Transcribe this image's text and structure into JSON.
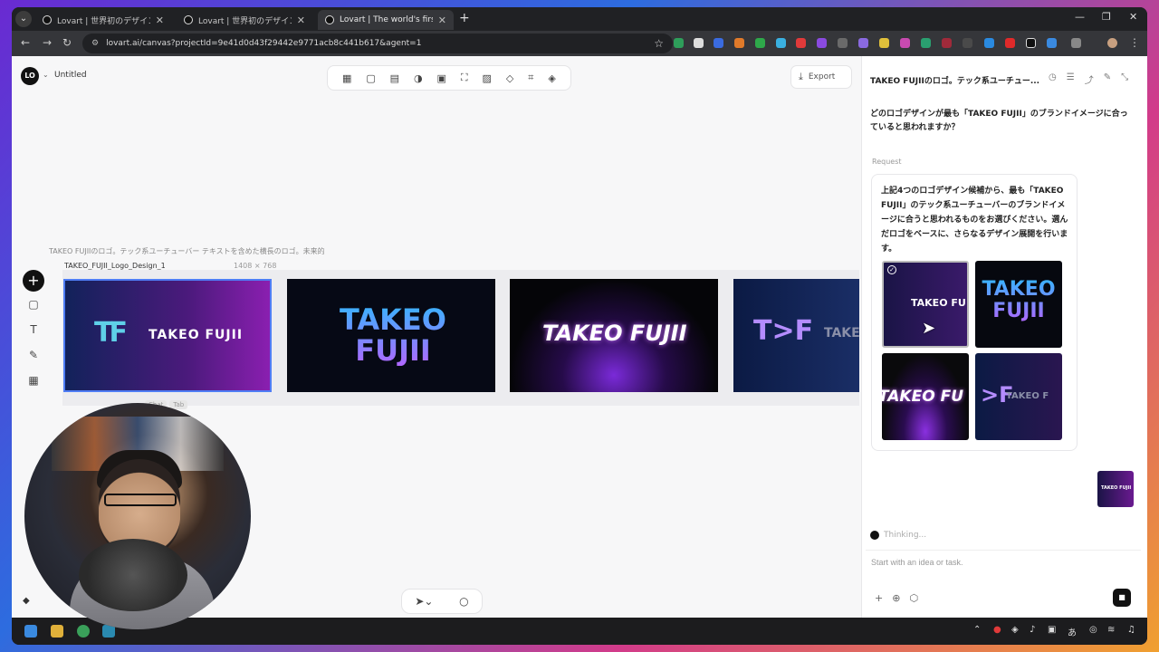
{
  "browser": {
    "tabs": [
      {
        "title": "Lovart | 世界初のデザインエージェント"
      },
      {
        "title": "Lovart | 世界初のデザインエージェント"
      },
      {
        "title": "Lovart | The world's first design agent"
      }
    ],
    "url": "lovart.ai/canvas?projectId=9e41d0d43f29442e9771acb8c441b617&agent=1"
  },
  "app": {
    "project_title": "Untitled",
    "export_label": "Export",
    "canvas_caption": "TAKEO FUJIIのロゴ。テック系ユーチューバー テキストを含めた横長のロゴ。未来的",
    "frame_label": "TAKEO_FUJII_Logo_Design_1",
    "frame_size": "1408 × 768",
    "cards": [
      {
        "text": "TAKEO FUJII",
        "mark": "TF"
      },
      {
        "line1": "TAKEO",
        "line2": "FUJII"
      },
      {
        "text": "TAKEO FUJII"
      },
      {
        "mark": "T>F",
        "text": "TAKE"
      }
    ],
    "hint_chat": "Chat",
    "hint_key": "Tab"
  },
  "panel": {
    "header": "TAKEO FUJIIのロゴ。テック系ユーチュー...",
    "question": "どのロゴデザインが最も「TAKEO FUJII」のブランドイメージに合っていると思われますか？",
    "request_label": "Request",
    "request_text": "上記4つのロゴデザイン候補から、最も「TAKEO FUJII」のテック系ユーチューバーのブランドイメージに合うと思われるものをお選びください。選んだロゴをベースに、さらなるデザイン展開を行います。",
    "thumbs": [
      {
        "text": "TAKEO FU"
      },
      {
        "line1": "TAKEO",
        "line2": "FUJII"
      },
      {
        "text": "TAKEO FU"
      },
      {
        "mark": ">F",
        "text": "TAKEO F"
      }
    ],
    "mini_thumb_text": "TAKEO FUJII",
    "thinking": "Thinking...",
    "composer_placeholder": "Start with an idea or task."
  },
  "colors": {
    "accent": "#4f7df5",
    "purple": "#8a1fb0"
  }
}
